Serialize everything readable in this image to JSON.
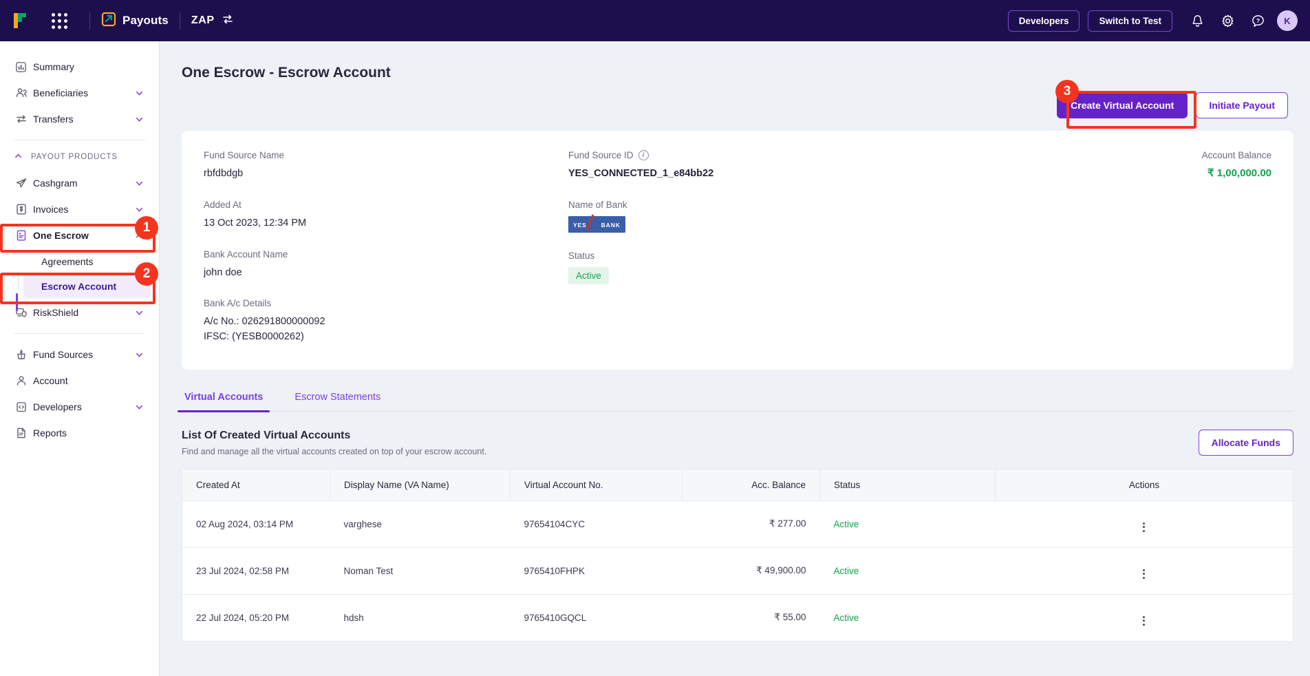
{
  "topbar": {
    "logo_icon": "cashfree-logo-icon",
    "grid_icon": "app-grid-icon",
    "app_name": "Payouts",
    "app_icon": "payouts-icon",
    "env_name": "ZAP",
    "env_switch_icon": "switch-icon",
    "developers_label": "Developers",
    "switch_to_test_label": "Switch to Test",
    "bell_icon": "notification-bell-icon",
    "gear_icon": "settings-gear-icon",
    "help_icon": "help-question-icon",
    "avatar_initial": "K"
  },
  "sidebar": {
    "items": [
      {
        "label": "Summary",
        "icon": "chart-bar-icon",
        "expandable": false
      },
      {
        "label": "Beneficiaries",
        "icon": "people-icon",
        "expandable": true
      },
      {
        "label": "Transfers",
        "icon": "transfer-arrows-icon",
        "expandable": true
      }
    ],
    "group_title": "PAYOUT PRODUCTS",
    "product_items": [
      {
        "label": "Cashgram",
        "icon": "paper-plane-icon",
        "expandable": true
      },
      {
        "label": "Invoices",
        "icon": "invoice-doc-icon",
        "expandable": true
      },
      {
        "label": "One Escrow",
        "icon": "escrow-book-icon",
        "expandable": true,
        "expanded": true
      }
    ],
    "sub_items": [
      {
        "label": "Agreements",
        "active": false
      },
      {
        "label": "Escrow Account",
        "active": true
      }
    ],
    "risk_item": {
      "label": "RiskShield",
      "icon": "riskshield-icon",
      "expandable": true
    },
    "bottom_items": [
      {
        "label": "Fund Sources",
        "icon": "fund-sources-icon",
        "expandable": true
      },
      {
        "label": "Account",
        "icon": "person-icon",
        "expandable": false
      },
      {
        "label": "Developers",
        "icon": "code-clipboard-icon",
        "expandable": true
      },
      {
        "label": "Reports",
        "icon": "report-doc-icon",
        "expandable": false
      }
    ]
  },
  "page": {
    "title": "One Escrow - Escrow Account",
    "create_virtual_account_label": "Create Virtual Account",
    "initiate_payout_label": "Initiate Payout"
  },
  "details": {
    "fund_source_name_label": "Fund Source Name",
    "fund_source_name_value": "rbfdbdgb",
    "added_at_label": "Added At",
    "added_at_value": "13 Oct 2023, 12:34 PM",
    "bank_account_name_label": "Bank Account Name",
    "bank_account_name_value": "john doe",
    "bank_ac_details_label": "Bank A/c Details",
    "bank_ac_no": "A/c No.: 026291800000092",
    "bank_ifsc": "IFSC: (YESB0000262)",
    "fund_source_id_label": "Fund Source ID",
    "fund_source_id_info_icon": "info-icon",
    "fund_source_id_value": "YES_CONNECTED_1_e84bb22",
    "name_of_bank_label": "Name of Bank",
    "bank_logo_left": "YES",
    "bank_logo_right": "BANK",
    "status_label": "Status",
    "status_value": "Active",
    "account_balance_label": "Account Balance",
    "account_balance_value": "₹ 1,00,000.00"
  },
  "tabs": [
    {
      "label": "Virtual Accounts",
      "active": true
    },
    {
      "label": "Escrow Statements",
      "active": false
    }
  ],
  "list": {
    "title": "List Of Created Virtual Accounts",
    "subtitle": "Find and manage all the virtual accounts created on top of your escrow account.",
    "allocate_funds_label": "Allocate Funds",
    "columns": [
      "Created At",
      "Display Name (VA Name)",
      "Virtual Account No.",
      "Acc. Balance",
      "Status",
      "Actions"
    ],
    "rows": [
      {
        "created_at": "02 Aug 2024, 03:14 PM",
        "display_name": "varghese",
        "account_no": "97654104CYC",
        "balance": "₹ 277.00",
        "status": "Active",
        "actions_icon": "kebab-menu-icon"
      },
      {
        "created_at": "23 Jul 2024, 02:58 PM",
        "display_name": "Noman Test",
        "account_no": "9765410FHPK",
        "balance": "₹ 49,900.00",
        "status": "Active",
        "actions_icon": "kebab-menu-icon"
      },
      {
        "created_at": "22 Jul 2024, 05:20 PM",
        "display_name": "hdsh",
        "account_no": "9765410GQCL",
        "balance": "₹ 55.00",
        "status": "Active",
        "actions_icon": "kebab-menu-icon"
      }
    ]
  },
  "annotations": [
    {
      "number": "1"
    },
    {
      "number": "2"
    },
    {
      "number": "3"
    }
  ],
  "colors": {
    "brand_purple": "#6522c9",
    "nav_dark": "#1d0f4e",
    "success_green": "#10a34a",
    "annotation_red": "#f5341f"
  }
}
